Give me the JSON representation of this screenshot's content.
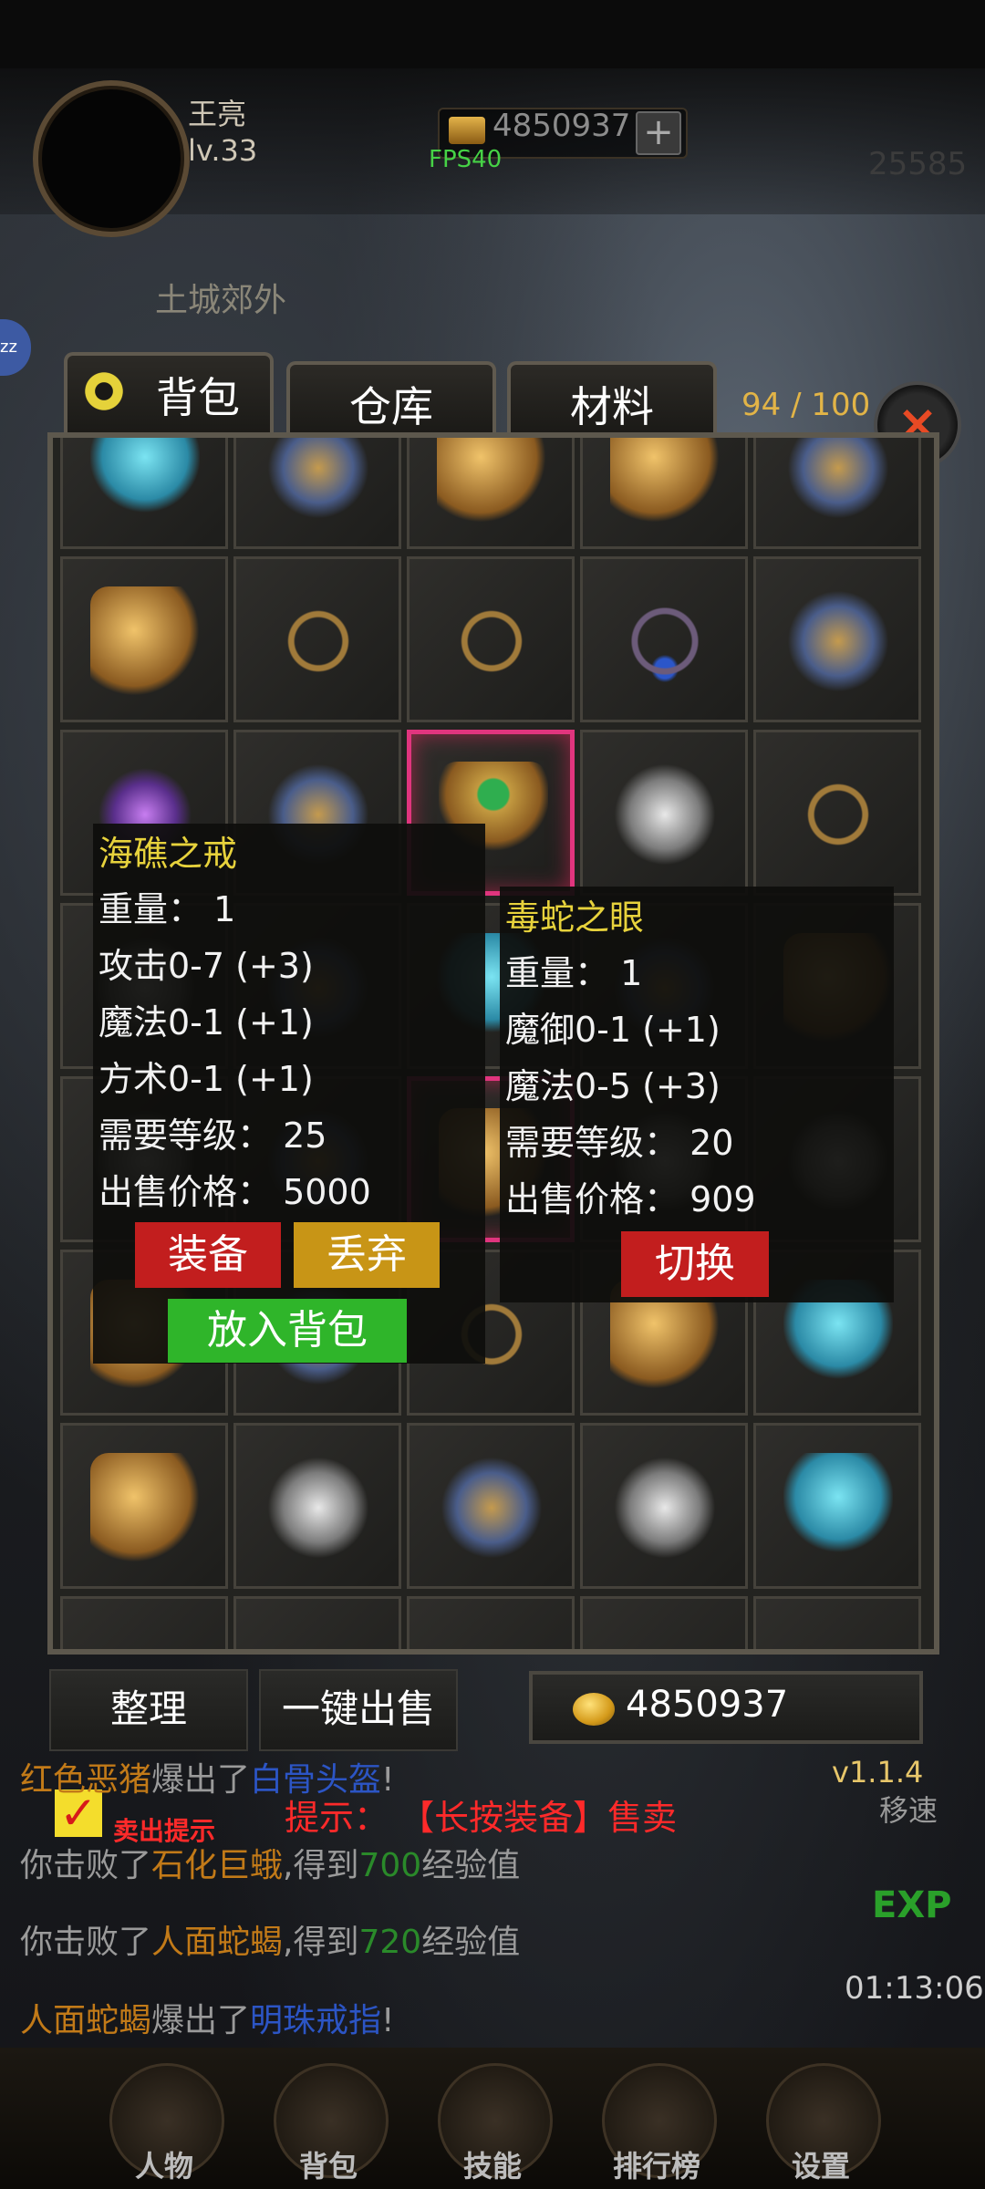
{
  "hud": {
    "player_name": "王亮",
    "player_level": "lv.33",
    "gold": "4850937",
    "plus": "+",
    "fps": "FPS40",
    "power": "25585",
    "location": "土城郊外",
    "sleep_badge": "zz"
  },
  "tabs": {
    "bag": "背包",
    "warehouse": "仓库",
    "materials": "材料",
    "capacity": "94 / 100",
    "close": "×"
  },
  "tooltip_left": {
    "name": "海礁之戒",
    "weight": "重量：  1",
    "attack": "攻击0-7 (+3)",
    "magic": "魔法0-1 (+1)",
    "taoism": "方术0-1 (+1)",
    "required_level": "需要等级：  25",
    "sell_price": "出售价格：  5000",
    "equip": "装备",
    "discard": "丢弃",
    "put_in_bag": "放入背包"
  },
  "tooltip_right": {
    "name": "毒蛇之眼",
    "weight": "重量：  1",
    "magic_defense": "魔御0-1 (+1)",
    "magic": "魔法0-5 (+3)",
    "required_level": "需要等级：  20",
    "sell_price": "出售价格：  909",
    "switch": "切换"
  },
  "controls": {
    "sort": "整理",
    "sell_all": "一键出售",
    "gold": "4850937",
    "version": "v1.1.4",
    "move_speed": "移速",
    "check": "✓",
    "sell_tip": "卖出提示",
    "hint": "提示：  【长按装备】售卖",
    "exp": "EXP",
    "clock": "01:13:06"
  },
  "log": {
    "l1a": "红色恶猪",
    "l1b": "爆出了",
    "l1c": "白骨头盔",
    "l1d": "!",
    "l2a": "你击败了",
    "l2b": "石化巨蛾",
    "l2c": ",得到",
    "l2d": "700",
    "l2e": "经验值",
    "l3a": "你击败了",
    "l3b": "人面蛇蝎",
    "l3c": ",得到",
    "l3d": "720",
    "l3e": "经验值",
    "l4a": "人面蛇蝎",
    "l4b": "爆出了",
    "l4c": "明珠戒指",
    "l4d": "!"
  },
  "nav": {
    "character": "人物",
    "bag": "背包",
    "skills": "技能",
    "ranking": "排行榜",
    "settings": "设置"
  },
  "colors": {
    "selected_border": "#e0357e",
    "item_name": "#e7d23c",
    "equip_button": "#c21e1e",
    "discard_button": "#c89516",
    "put_bag_button": "#2fb52a"
  }
}
